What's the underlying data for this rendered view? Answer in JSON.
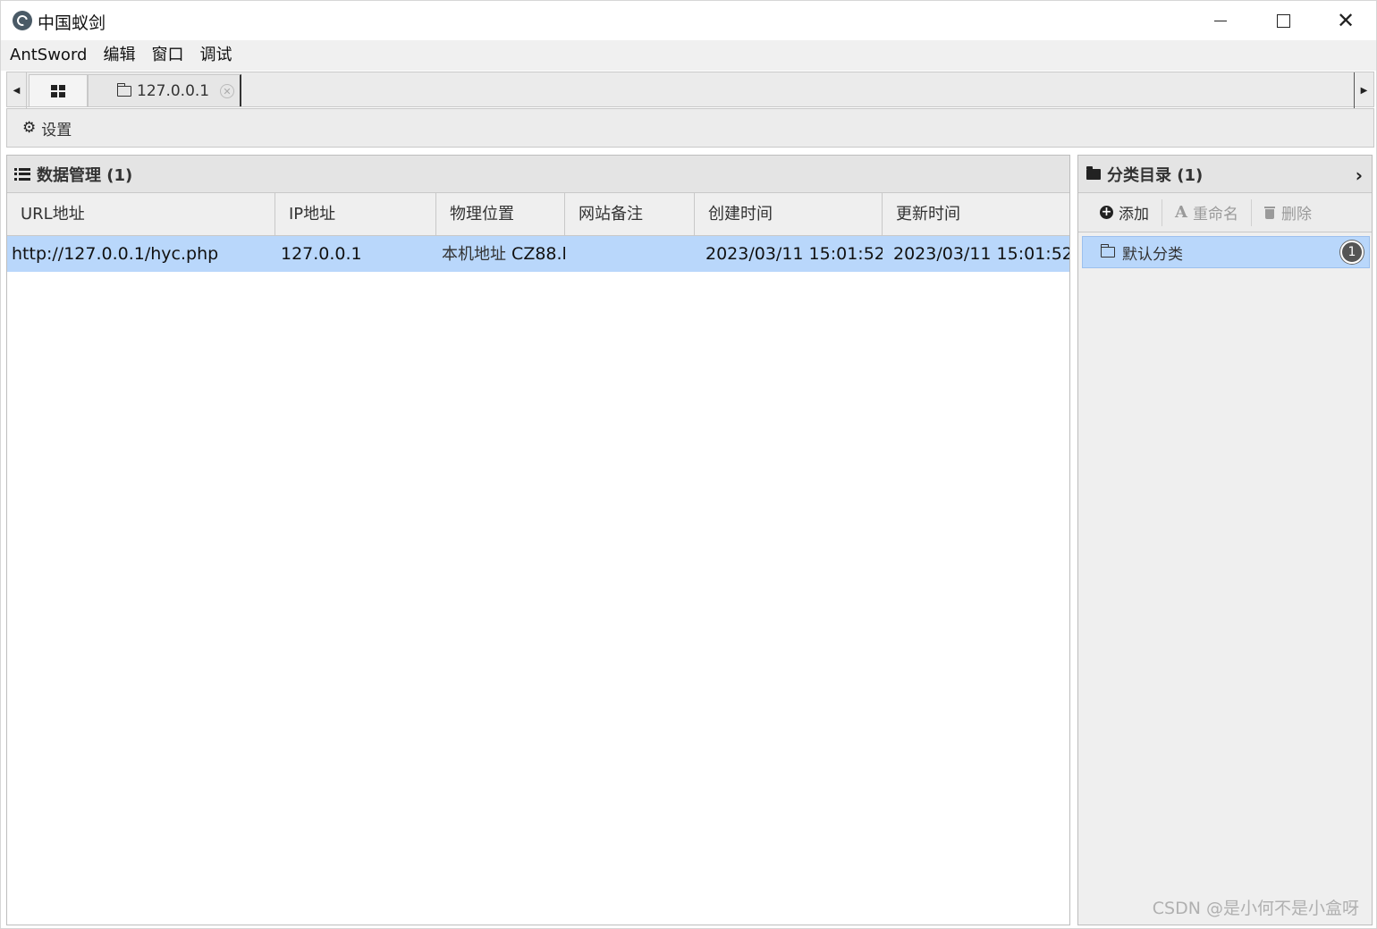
{
  "window": {
    "title": "中国蚁剑"
  },
  "menu": {
    "items": [
      "AntSword",
      "编辑",
      "窗口",
      "调试"
    ]
  },
  "tabs": {
    "host_tab_label": "127.0.0.1"
  },
  "toolbar": {
    "settings_label": "设置"
  },
  "data_panel": {
    "title": "数据管理 (1)",
    "columns": [
      "URL地址",
      "IP地址",
      "物理位置",
      "网站备注",
      "创建时间",
      "更新时间"
    ],
    "rows": [
      {
        "url": "http://127.0.0.1/hyc.php",
        "ip": "127.0.0.1",
        "location_prefix": "本机地址",
        "location_suffix": "CZ88.l",
        "note": "",
        "created": "2023/03/11 15:01:52",
        "updated": "2023/03/11 15:01:52"
      }
    ]
  },
  "category_panel": {
    "title": "分类目录 (1)",
    "add_label": "添加",
    "rename_label": "重命名",
    "delete_label": "删除",
    "items": [
      {
        "label": "默认分类",
        "count": "1"
      }
    ]
  },
  "watermark": "CSDN @是小何不是小盒呀",
  "colors": {
    "selection": "#b9d7fb",
    "panel_header": "#e4e4e4",
    "disabled_text": "#9a9a9a"
  }
}
